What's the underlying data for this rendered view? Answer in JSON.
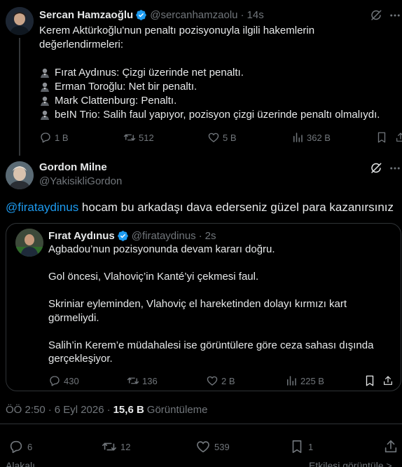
{
  "parent_tweet": {
    "author_name": "Sercan Hamzaoğlu",
    "handle": "@sercanhamzaolu",
    "time": "14s",
    "separator": "·",
    "intro_line1": "Kerem Aktürkoğlu'nun penaltı pozisyonuyla ilgili hakemlerin",
    "intro_line2": "değerlendirmeleri:",
    "opinions": [
      "Fırat Aydınus: Çizgi üzerinde net penaltı.",
      "Erman Toroğlu: Net bir penaltı.",
      "Mark Clattenburg: Penaltı.",
      "beIN Trio: Salih faul yapıyor, pozisyon çizgi üzerinde penaltı olmalıydı."
    ],
    "replies": "1 B",
    "reposts": "512",
    "likes": "5 B",
    "views": "362 B"
  },
  "main_tweet": {
    "author_name": "Gordon Milne",
    "handle": "@YakisikliGordon",
    "mention": "@firataydinus",
    "text": " hocam bu arkadaşı dava ederseniz güzel para kazanırsınız"
  },
  "quoted_tweet": {
    "author_name": "Fırat Aydınus",
    "handle": "@firataydinus",
    "separator": "·",
    "time": "2s",
    "paragraphs": [
      "Agbadou’nun pozisyonunda  devam kararı doğru.",
      "Gol öncesi, Vlahoviç’in Kanté’yi çekmesi faul.",
      "Skriniar eyleminden, Vlahoviç el hareketinden dolayı  kırmızı kart görmeliydi.",
      "Salih’in Kerem’e müdahalesi ise görüntülere göre ceza sahası dışında gerçekleşiyor."
    ],
    "replies": "430",
    "reposts": "136",
    "likes": "2 B",
    "views": "225 B"
  },
  "meta": {
    "time": "ÖÖ 2:50",
    "separator": "·",
    "date": "6 Eyl 2026",
    "separator2": "·",
    "views_count": "15,6 B",
    "views_label": "Görüntüleme"
  },
  "footer_actions": {
    "replies": "6",
    "reposts": "12",
    "likes": "539",
    "bookmarks": "1"
  },
  "cutoff": {
    "left": "Alakalı",
    "right": "Etkileşi görüntüle >"
  },
  "colors": {
    "background": "#000000",
    "text_primary": "#e7e9ea",
    "text_secondary": "#71767b",
    "link": "#1d9bf0",
    "verified": "#1d9bf0",
    "border": "#2f3336"
  }
}
